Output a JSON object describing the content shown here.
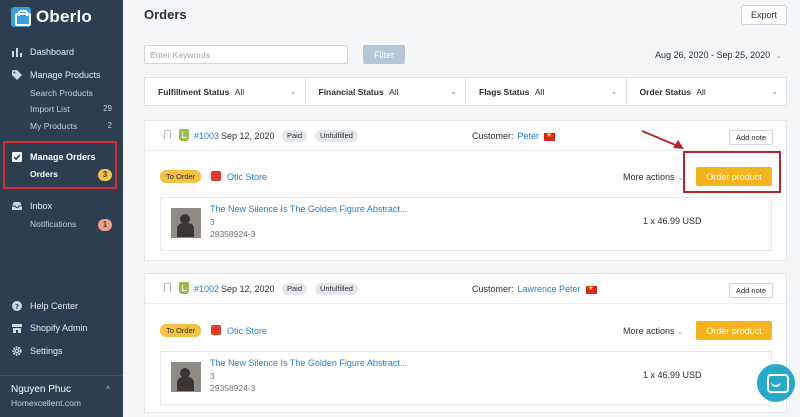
{
  "app": {
    "logo_text": "Oberlo"
  },
  "sidebar": {
    "items": [
      {
        "label": "Dashboard",
        "icon": "dashboard-icon"
      },
      {
        "label": "Manage Products",
        "icon": "tag-icon",
        "children": [
          {
            "label": "Search Products",
            "count": ""
          },
          {
            "label": "Import List",
            "count": "29"
          },
          {
            "label": "My Products",
            "count": "2"
          }
        ]
      },
      {
        "label": "Manage Orders",
        "icon": "checkbox-icon",
        "children": [
          {
            "label": "Orders",
            "count": "3",
            "active": true
          }
        ]
      },
      {
        "label": "Inbox",
        "icon": "inbox-icon",
        "children": [
          {
            "label": "Notifications",
            "count": "1"
          }
        ]
      }
    ],
    "bottom_items": [
      {
        "label": "Help Center",
        "icon": "help-icon"
      },
      {
        "label": "Shopify Admin",
        "icon": "store-icon"
      },
      {
        "label": "Settings",
        "icon": "gear-icon"
      }
    ],
    "user": {
      "name": "Nguyen Phuc",
      "site": "Homexcellent.com"
    }
  },
  "header": {
    "title": "Orders",
    "export_label": "Export"
  },
  "search": {
    "placeholder": "Enter Keywords",
    "filter_label": "Filter"
  },
  "date_range": {
    "label": "Aug 26, 2020 - Sep 25, 2020"
  },
  "filters": [
    {
      "label": "Fulfillment Status",
      "value": "All"
    },
    {
      "label": "Financial Status",
      "value": "All"
    },
    {
      "label": "Flags Status",
      "value": "All"
    },
    {
      "label": "Order Status",
      "value": "All"
    }
  ],
  "orders": [
    {
      "number": "#1003",
      "date": "Sep 12, 2020",
      "badges": [
        "Paid",
        "Unfulfilled"
      ],
      "customer_label": "Customer:",
      "customer": "Peter",
      "add_note": "Add note",
      "to_order": "To Order",
      "store": "Otic Store",
      "more_actions": "More actions",
      "order_button": "Order product",
      "product": {
        "title": "The New Silence Is The Golden Figure Abstract...",
        "qty": "3",
        "sku": "29358924-3",
        "price": "1 x 46.99 USD"
      }
    },
    {
      "number": "#1002",
      "date": "Sep 12, 2020",
      "badges": [
        "Paid",
        "Unfulfilled"
      ],
      "customer_label": "Customer:",
      "customer": "Lawrence Peter",
      "add_note": "Add note",
      "to_order": "To Order",
      "store": "Otic Store",
      "more_actions": "More actions",
      "order_button": "Order product",
      "product": {
        "title": "The New Silence Is The Golden Figure Abstract...",
        "qty": "3",
        "sku": "29358924-3",
        "price": "1 x 46.99 USD"
      }
    }
  ],
  "colors": {
    "sidebar": "#2c3e50",
    "accent": "#f7b31e",
    "link": "#2b7ec2",
    "highlight": "#d32f2f"
  }
}
